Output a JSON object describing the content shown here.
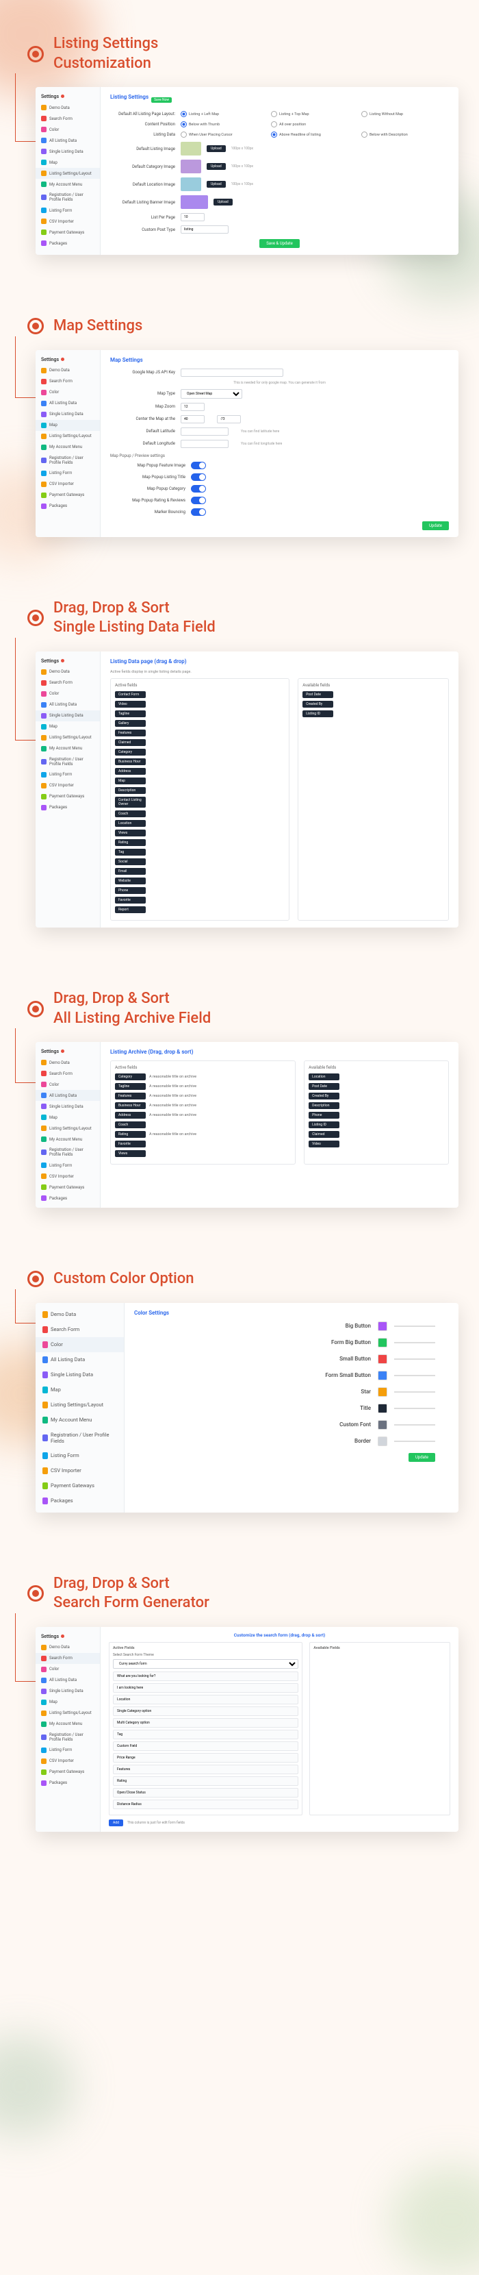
{
  "sections": {
    "s1": {
      "title": "Listing Settings\nCustomization"
    },
    "s2": {
      "title": "Map Settings"
    },
    "s3": {
      "title": "Drag, Drop & Sort\nSingle Listing Data Field"
    },
    "s4": {
      "title": "Drag, Drop & Sort\nAll Listing Archive Field"
    },
    "s5": {
      "title": "Custom Color Option"
    },
    "s6": {
      "title": "Drag, Drop & Sort\nSearch Form Generator"
    }
  },
  "sidebar": {
    "header": "Settings",
    "items": [
      {
        "label": "Demo Data",
        "color": "#f59e0b"
      },
      {
        "label": "Search Form",
        "color": "#ef4444"
      },
      {
        "label": "Color",
        "color": "#ec4899"
      },
      {
        "label": "All Listing Data",
        "color": "#3b82f6"
      },
      {
        "label": "Single Listing Data",
        "color": "#8b5cf6"
      },
      {
        "label": "Map",
        "color": "#06b6d4"
      },
      {
        "label": "Listing Settings/Layout",
        "color": "#f59e0b"
      },
      {
        "label": "My Account Menu",
        "color": "#10b981"
      },
      {
        "label": "Registration / User Profile Fields",
        "color": "#6366f1"
      },
      {
        "label": "Listing Form",
        "color": "#0ea5e9"
      },
      {
        "label": "CSV Importer",
        "color": "#f59e0b"
      },
      {
        "label": "Payment Gateways",
        "color": "#84cc16"
      },
      {
        "label": "Packages",
        "color": "#a855f7"
      }
    ]
  },
  "listing_settings": {
    "heading": "Listing Settings",
    "badge": "Save Now",
    "rows": {
      "layout": "Default All Listing Page Layout:",
      "position": "Content Position",
      "data": "Listing Data",
      "def_img": "Default Listing Image",
      "cat_img": "Default Category Image",
      "loc_img": "Default Location Image",
      "ban_img": "Default Listing Banner Image",
      "per_page": "List Per Page",
      "post_type": "Custom Post Type"
    },
    "radio_layout": [
      "Listing + Left Map",
      "Listing + Top Map",
      "Listing Without Map"
    ],
    "radio_position": [
      "Below with Thumb",
      "All over position",
      ""
    ],
    "radio_data": [
      "Above Headline of listing",
      "When User Placing Cursor",
      "Below with Description"
    ],
    "upload": "Upload",
    "image_size": "100px x 100px",
    "save": "Save & Update"
  },
  "map_settings": {
    "heading": "Map Settings",
    "api_label": "Google Map JS API Key",
    "api_note": "This is needed for only google map. You can generate it from",
    "type": "Map Type",
    "type_val": "Open Street Map",
    "zoom": "Map Zoom",
    "center": "Center the Map at the",
    "lat": "Default Latitude",
    "lat_note": "You can find latitude here",
    "lng": "Default Longitude",
    "lng_note": "You can find longitude here",
    "popup_h": "Map Popup / Preview settings",
    "toggles": [
      "Map Popup Feature Image",
      "Map Popup Listing Title",
      "Map Popup Category",
      "Map Popup Rating & Reviews",
      "Marker Bouncing"
    ],
    "update": "Update"
  },
  "single_listing": {
    "heading": "Listing Data page (drag & drop)",
    "note": "Active fields display in single listing details page.",
    "active_h": "Active fields",
    "available_h": "Available fields",
    "active": [
      "Contact Form",
      "Video",
      "Tagline",
      "Gallery",
      "Features",
      "Claimed",
      "Category",
      "Business Hour",
      "Address",
      "Map",
      "Description",
      "Contact Listing Owner",
      "Coach",
      "Location",
      "Views",
      "Rating",
      "Tag",
      "Social",
      "Email",
      "Website",
      "Phone",
      "Favorite",
      "Report"
    ],
    "available": [
      "Post Date",
      "Created By",
      "Listing ID"
    ]
  },
  "archive": {
    "heading": "Listing Archive (Drag, drop & sort)",
    "active_h": "Active fields",
    "available_h": "Available fields",
    "active": [
      "Category",
      "Tagline",
      "Features",
      "Business Hour",
      "Address",
      "Coach",
      "Rating",
      "Favorite",
      "Views"
    ],
    "active_right": [
      "A reasonable title on archive",
      "A reasonable title on archive",
      "A reasonable title on archive",
      "A reasonable title on archive",
      "A reasonable title on archive",
      "",
      "A reasonable title on archive",
      "",
      ""
    ],
    "available": [
      "Location",
      "Post Date",
      "Created By",
      "Description",
      "Phone",
      "Listing ID",
      "Claimed",
      "Video"
    ]
  },
  "color": {
    "heading": "Color Settings",
    "items": [
      {
        "label": "Big Button",
        "c": "#a855f7"
      },
      {
        "label": "Form Big Button",
        "c": "#22c55e"
      },
      {
        "label": "Small Button",
        "c": "#ef4444"
      },
      {
        "label": "Form Small Button",
        "c": "#3b82f6"
      },
      {
        "label": "Star",
        "c": "#f59e0b"
      },
      {
        "label": "Title",
        "c": "#1f2937"
      },
      {
        "label": "Custom Font",
        "c": "#6b7280"
      },
      {
        "label": "Border",
        "c": "#d1d5db"
      }
    ],
    "update": "Update"
  },
  "search": {
    "heading": "Customize the search form (drag, drop & sort)",
    "active_h": "Active Fields",
    "available_h": "Available Fields",
    "select_label": "Select Search Form Theme",
    "select_val": "Curvy search form",
    "fields": [
      "What are you looking for?",
      "I am looking here",
      "Location",
      "Single Category option",
      "Multi Category option",
      "Tag",
      "Custom Field",
      "Price Range",
      "Features",
      "Rating",
      "Open/Close Status",
      "Distance Radius"
    ],
    "add": "Add",
    "note2": "This column is just for edit form fields"
  }
}
